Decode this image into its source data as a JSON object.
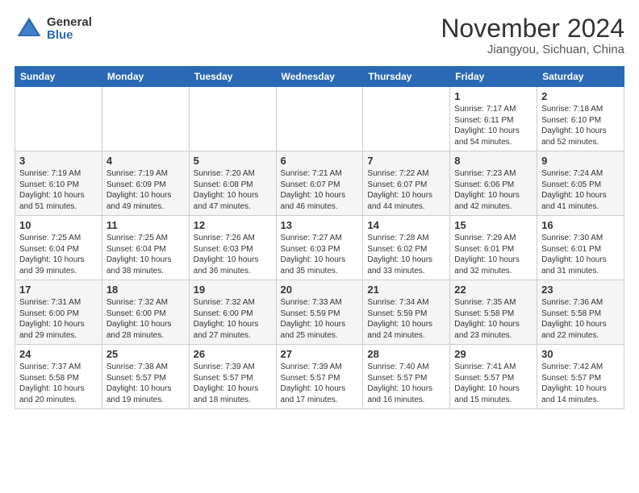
{
  "header": {
    "logo_general": "General",
    "logo_blue": "Blue",
    "month_title": "November 2024",
    "location": "Jiangyou, Sichuan, China"
  },
  "days_of_week": [
    "Sunday",
    "Monday",
    "Tuesday",
    "Wednesday",
    "Thursday",
    "Friday",
    "Saturday"
  ],
  "weeks": [
    [
      {
        "day": "",
        "content": ""
      },
      {
        "day": "",
        "content": ""
      },
      {
        "day": "",
        "content": ""
      },
      {
        "day": "",
        "content": ""
      },
      {
        "day": "",
        "content": ""
      },
      {
        "day": "1",
        "content": "Sunrise: 7:17 AM\nSunset: 6:11 PM\nDaylight: 10 hours and 54 minutes."
      },
      {
        "day": "2",
        "content": "Sunrise: 7:18 AM\nSunset: 6:10 PM\nDaylight: 10 hours and 52 minutes."
      }
    ],
    [
      {
        "day": "3",
        "content": "Sunrise: 7:19 AM\nSunset: 6:10 PM\nDaylight: 10 hours and 51 minutes."
      },
      {
        "day": "4",
        "content": "Sunrise: 7:19 AM\nSunset: 6:09 PM\nDaylight: 10 hours and 49 minutes."
      },
      {
        "day": "5",
        "content": "Sunrise: 7:20 AM\nSunset: 6:08 PM\nDaylight: 10 hours and 47 minutes."
      },
      {
        "day": "6",
        "content": "Sunrise: 7:21 AM\nSunset: 6:07 PM\nDaylight: 10 hours and 46 minutes."
      },
      {
        "day": "7",
        "content": "Sunrise: 7:22 AM\nSunset: 6:07 PM\nDaylight: 10 hours and 44 minutes."
      },
      {
        "day": "8",
        "content": "Sunrise: 7:23 AM\nSunset: 6:06 PM\nDaylight: 10 hours and 42 minutes."
      },
      {
        "day": "9",
        "content": "Sunrise: 7:24 AM\nSunset: 6:05 PM\nDaylight: 10 hours and 41 minutes."
      }
    ],
    [
      {
        "day": "10",
        "content": "Sunrise: 7:25 AM\nSunset: 6:04 PM\nDaylight: 10 hours and 39 minutes."
      },
      {
        "day": "11",
        "content": "Sunrise: 7:25 AM\nSunset: 6:04 PM\nDaylight: 10 hours and 38 minutes."
      },
      {
        "day": "12",
        "content": "Sunrise: 7:26 AM\nSunset: 6:03 PM\nDaylight: 10 hours and 36 minutes."
      },
      {
        "day": "13",
        "content": "Sunrise: 7:27 AM\nSunset: 6:03 PM\nDaylight: 10 hours and 35 minutes."
      },
      {
        "day": "14",
        "content": "Sunrise: 7:28 AM\nSunset: 6:02 PM\nDaylight: 10 hours and 33 minutes."
      },
      {
        "day": "15",
        "content": "Sunrise: 7:29 AM\nSunset: 6:01 PM\nDaylight: 10 hours and 32 minutes."
      },
      {
        "day": "16",
        "content": "Sunrise: 7:30 AM\nSunset: 6:01 PM\nDaylight: 10 hours and 31 minutes."
      }
    ],
    [
      {
        "day": "17",
        "content": "Sunrise: 7:31 AM\nSunset: 6:00 PM\nDaylight: 10 hours and 29 minutes."
      },
      {
        "day": "18",
        "content": "Sunrise: 7:32 AM\nSunset: 6:00 PM\nDaylight: 10 hours and 28 minutes."
      },
      {
        "day": "19",
        "content": "Sunrise: 7:32 AM\nSunset: 6:00 PM\nDaylight: 10 hours and 27 minutes."
      },
      {
        "day": "20",
        "content": "Sunrise: 7:33 AM\nSunset: 5:59 PM\nDaylight: 10 hours and 25 minutes."
      },
      {
        "day": "21",
        "content": "Sunrise: 7:34 AM\nSunset: 5:59 PM\nDaylight: 10 hours and 24 minutes."
      },
      {
        "day": "22",
        "content": "Sunrise: 7:35 AM\nSunset: 5:58 PM\nDaylight: 10 hours and 23 minutes."
      },
      {
        "day": "23",
        "content": "Sunrise: 7:36 AM\nSunset: 5:58 PM\nDaylight: 10 hours and 22 minutes."
      }
    ],
    [
      {
        "day": "24",
        "content": "Sunrise: 7:37 AM\nSunset: 5:58 PM\nDaylight: 10 hours and 20 minutes."
      },
      {
        "day": "25",
        "content": "Sunrise: 7:38 AM\nSunset: 5:57 PM\nDaylight: 10 hours and 19 minutes."
      },
      {
        "day": "26",
        "content": "Sunrise: 7:39 AM\nSunset: 5:57 PM\nDaylight: 10 hours and 18 minutes."
      },
      {
        "day": "27",
        "content": "Sunrise: 7:39 AM\nSunset: 5:57 PM\nDaylight: 10 hours and 17 minutes."
      },
      {
        "day": "28",
        "content": "Sunrise: 7:40 AM\nSunset: 5:57 PM\nDaylight: 10 hours and 16 minutes."
      },
      {
        "day": "29",
        "content": "Sunrise: 7:41 AM\nSunset: 5:57 PM\nDaylight: 10 hours and 15 minutes."
      },
      {
        "day": "30",
        "content": "Sunrise: 7:42 AM\nSunset: 5:57 PM\nDaylight: 10 hours and 14 minutes."
      }
    ]
  ],
  "colors": {
    "header_bg": "#2a6ab5",
    "header_text": "#ffffff",
    "row_even": "#f0f0f0",
    "row_odd": "#ffffff"
  }
}
